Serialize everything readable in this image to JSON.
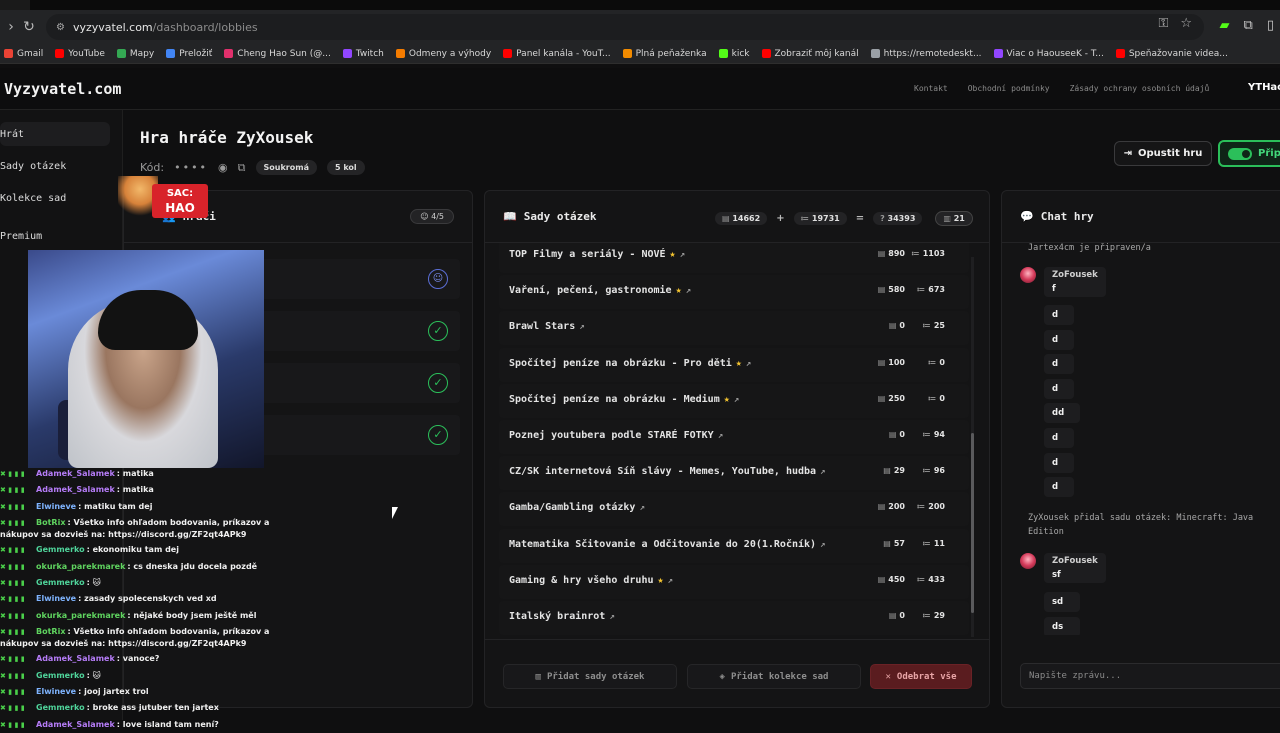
{
  "browser": {
    "url_host": "vyzyvatel.com",
    "url_path": "/dashboard/lobbies",
    "bookmarks": [
      {
        "label": "Gmail",
        "color": "#ea4335"
      },
      {
        "label": "YouTube",
        "color": "#ff0000"
      },
      {
        "label": "Mapy",
        "color": "#34a853"
      },
      {
        "label": "Preložiť",
        "color": "#4285f4"
      },
      {
        "label": "Cheng Hao Sun (@...",
        "color": "#e1306c"
      },
      {
        "label": "Twitch",
        "color": "#9146ff"
      },
      {
        "label": "Odmeny a výhody",
        "color": "#f57c00"
      },
      {
        "label": "Panel kanála - YouT...",
        "color": "#ff0000"
      },
      {
        "label": "Plná peňaženka",
        "color": "#f28b00"
      },
      {
        "label": "kick",
        "color": "#53fc18"
      },
      {
        "label": "Zobraziť môj kanál",
        "color": "#ff0000"
      },
      {
        "label": "https://remotedeskt...",
        "color": "#9aa0a6"
      },
      {
        "label": "Viac o HaouseeK - T...",
        "color": "#9146ff"
      },
      {
        "label": "Speňažovanie videa...",
        "color": "#ff0000"
      }
    ]
  },
  "header": {
    "logo": "Vyzyvatel.com",
    "nav": [
      "Kontakt",
      "Obchodní podmínky",
      "Zásady ochrany osobních údajů"
    ],
    "user": "YTHaou"
  },
  "sidebar": {
    "items": [
      "Hrát",
      "Sady otázek",
      "Kolekce sad",
      "Premium"
    ]
  },
  "stream": {
    "sac_label": "SAC:",
    "sac_code": "HAO",
    "chat": [
      {
        "user": "Adamek_Salamek",
        "color": "#b57cf7",
        "msg": "matika"
      },
      {
        "user": "Adamek_Salamek",
        "color": "#b57cf7",
        "msg": "matika"
      },
      {
        "user": "Elwineve",
        "color": "#7fb4ff",
        "msg": "matiku tam dej"
      },
      {
        "user": "BotRix",
        "color": "#5fd35f",
        "msg": "Všetko info ohľadom bodovania, príkazov a nákupov sa dozvieš na: https://discord.gg/ZF2qt4APk9"
      },
      {
        "user": "Gemmerko",
        "color": "#4fd39a",
        "msg": "ekonomiku tam dej"
      },
      {
        "user": "okurka_parekmarek",
        "color": "#5fd35f",
        "msg": "cs dneska jdu docela pozdě"
      },
      {
        "user": "Gemmerko",
        "color": "#4fd39a",
        "msg": "🐱"
      },
      {
        "user": "Elwineve",
        "color": "#7fb4ff",
        "msg": "zasady spolecenskych ved xd"
      },
      {
        "user": "okurka_parekmarek",
        "color": "#5fd35f",
        "msg": "nějaké body jsem ještě měl"
      },
      {
        "user": "BotRix",
        "color": "#5fd35f",
        "msg": "Všetko info ohľadom bodovania, príkazov a nákupov sa dozvieš na: https://discord.gg/ZF2qt4APk9"
      },
      {
        "user": "Adamek_Salamek",
        "color": "#b57cf7",
        "msg": "vanoce?"
      },
      {
        "user": "Gemmerko",
        "color": "#4fd39a",
        "msg": "🐱"
      },
      {
        "user": "Elwineve",
        "color": "#7fb4ff",
        "msg": "jooj jartex trol"
      },
      {
        "user": "Gemmerko",
        "color": "#4fd39a",
        "msg": "broke ass jutuber ten jartex"
      },
      {
        "user": "Adamek_Salamek",
        "color": "#b57cf7",
        "msg": "love island tam není?"
      }
    ]
  },
  "game": {
    "title": "Hra hráče ZyXousek",
    "code_label": "Kód:",
    "code_mask": "••••",
    "privacy": "Soukromá",
    "rounds": "5 kol",
    "leave_label": "Opustit hru",
    "ready_label": "Připr"
  },
  "players": {
    "title": "Hráči",
    "count": "4/5"
  },
  "sets": {
    "title": "Sady otázek",
    "total_a": "14662",
    "op_plus": "+",
    "total_b": "19731",
    "op_eq": "=",
    "total_sum": "34393",
    "set_count": "21",
    "items": [
      {
        "name": "TOP Filmy a seriály - NOVÉ",
        "star": true,
        "a": "890",
        "b": "1103"
      },
      {
        "name": "Vaření, pečení, gastronomie",
        "star": true,
        "a": "580",
        "b": "673"
      },
      {
        "name": "Brawl Stars",
        "star": false,
        "a": "0",
        "b": "25"
      },
      {
        "name": "Spočítej peníze na obrázku - Pro děti",
        "star": true,
        "a": "100",
        "b": "0"
      },
      {
        "name": "Spočítej peníze na obrázku - Medium",
        "star": true,
        "a": "250",
        "b": "0"
      },
      {
        "name": "Poznej youtubera podle STARÉ FOTKY",
        "star": false,
        "a": "0",
        "b": "94"
      },
      {
        "name": "CZ/SK internetová Síň slávy - Memes, YouTube, hudba",
        "star": false,
        "a": "29",
        "b": "96"
      },
      {
        "name": "Gamba/Gambling otázky",
        "star": false,
        "a": "200",
        "b": "200"
      },
      {
        "name": "Matematika Sčitovanie a Odčitovanie do 20(1.Ročník)",
        "star": false,
        "a": "57",
        "b": "11"
      },
      {
        "name": "Gaming & hry všeho druhu",
        "star": true,
        "a": "450",
        "b": "433"
      },
      {
        "name": "Italský brainrot",
        "star": false,
        "a": "0",
        "b": "29"
      }
    ],
    "add_sets_label": "Přidat sady otázek",
    "add_collections_label": "Přidat kolekce sad",
    "remove_all_label": "Odebrat vše"
  },
  "chat": {
    "title": "Chat hry",
    "system_top": "Jartex4cm je připraven/a",
    "system_mid": "ZyXousek přidal sadu otázek: Minecraft: Java Edition",
    "author": "ZoFousek",
    "group1": [
      "f",
      "d",
      "d",
      "d",
      "d",
      "dd",
      "d",
      "d",
      "d"
    ],
    "group2": [
      "sf",
      "sd",
      "ds"
    ],
    "placeholder": "Napište zprávu..."
  }
}
